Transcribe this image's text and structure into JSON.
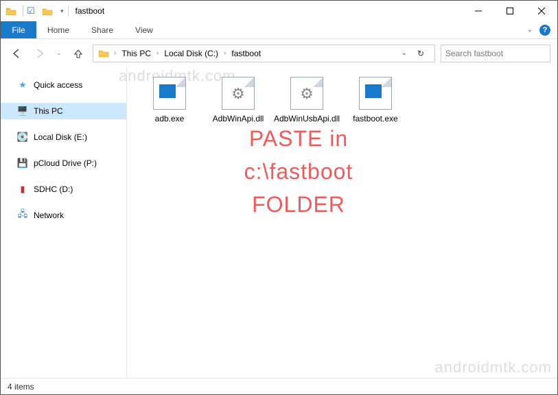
{
  "window": {
    "title": "fastboot"
  },
  "ribbon": {
    "file": "File",
    "tabs": [
      "Home",
      "Share",
      "View"
    ]
  },
  "address": {
    "crumbs": [
      "This PC",
      "Local Disk (C:)",
      "fastboot"
    ]
  },
  "search": {
    "placeholder": "Search fastboot"
  },
  "sidebar": {
    "items": [
      {
        "label": "Quick access",
        "type": "quick"
      },
      {
        "label": "This PC",
        "type": "pc",
        "selected": true
      },
      {
        "label": "Local Disk (E:)",
        "type": "disk"
      },
      {
        "label": "pCloud Drive (P:)",
        "type": "drive"
      },
      {
        "label": "SDHC (D:)",
        "type": "sd"
      },
      {
        "label": "Network",
        "type": "net"
      }
    ]
  },
  "files": [
    {
      "name": "adb.exe",
      "kind": "exe"
    },
    {
      "name": "AdbWinApi.dll",
      "kind": "dll"
    },
    {
      "name": "AdbWinUsbApi.dll",
      "kind": "dll"
    },
    {
      "name": "fastboot.exe",
      "kind": "exe"
    }
  ],
  "overlay": {
    "line1": "PASTE in",
    "line2": "c:\\fastboot",
    "line3": "FOLDER"
  },
  "watermark": "androidmtk.com",
  "status": {
    "count": "4 items"
  }
}
